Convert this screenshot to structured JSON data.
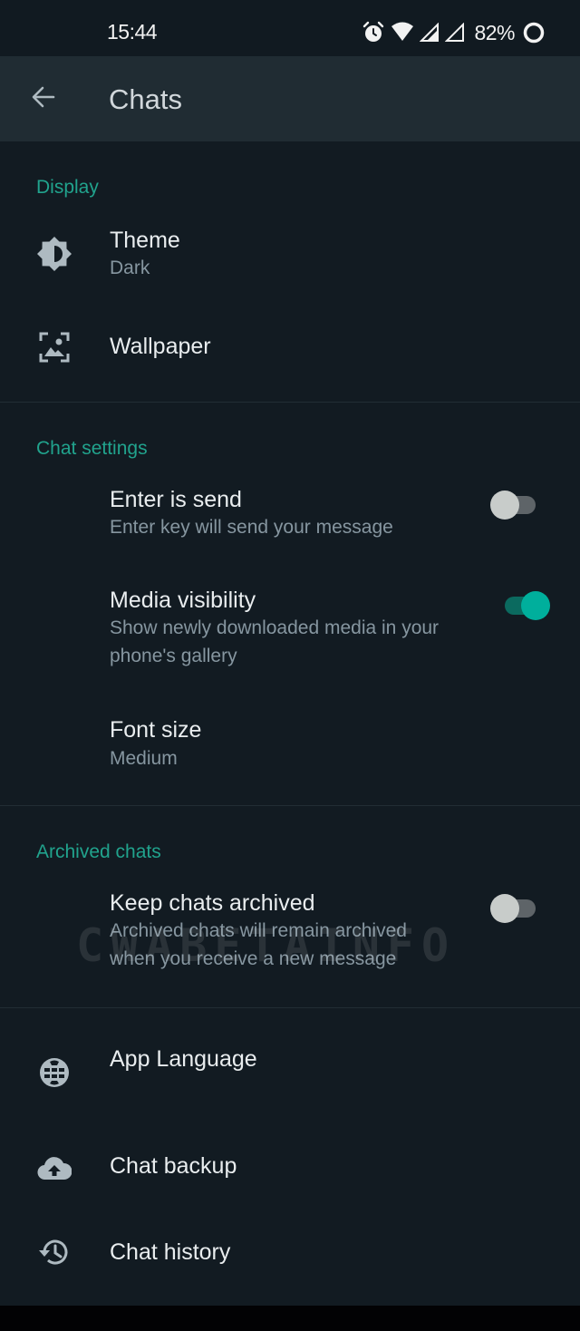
{
  "status_bar": {
    "time": "15:44",
    "battery_percent": "82%",
    "icons": [
      "alarm-icon",
      "wifi-icon",
      "signal-icon",
      "signal-icon",
      "battery-ring-icon"
    ]
  },
  "app_bar": {
    "back_icon": "arrow-left-icon",
    "title": "Chats"
  },
  "sections": {
    "display": {
      "header": "Display",
      "theme": {
        "icon": "brightness-icon",
        "title": "Theme",
        "value": "Dark"
      },
      "wallpaper": {
        "icon": "wallpaper-icon",
        "title": "Wallpaper"
      }
    },
    "chat_settings": {
      "header": "Chat settings",
      "enter_is_send": {
        "title": "Enter is send",
        "subtitle": "Enter key will send your message",
        "enabled": false
      },
      "media_visibility": {
        "title": "Media visibility",
        "subtitle": "Show newly downloaded media in your phone's gallery",
        "enabled": true
      },
      "font_size": {
        "title": "Font size",
        "value": "Medium"
      }
    },
    "archived_chats": {
      "header": "Archived chats",
      "keep_archived": {
        "title": "Keep chats archived",
        "subtitle": "Archived chats will remain archived when you receive a new message",
        "enabled": false
      }
    },
    "other": {
      "app_language": {
        "icon": "globe-icon",
        "title": "App Language"
      },
      "chat_backup": {
        "icon": "cloud-upload-icon",
        "title": "Chat backup"
      },
      "chat_history": {
        "icon": "history-icon",
        "title": "Chat history"
      }
    }
  },
  "watermark": "CWABETAINFO",
  "colors": {
    "accent": "#21a38d",
    "toggle_on_thumb": "#00af9c",
    "toggle_on_track": "#0b6a5f",
    "background": "#121b22",
    "app_bar": "#202c33"
  }
}
